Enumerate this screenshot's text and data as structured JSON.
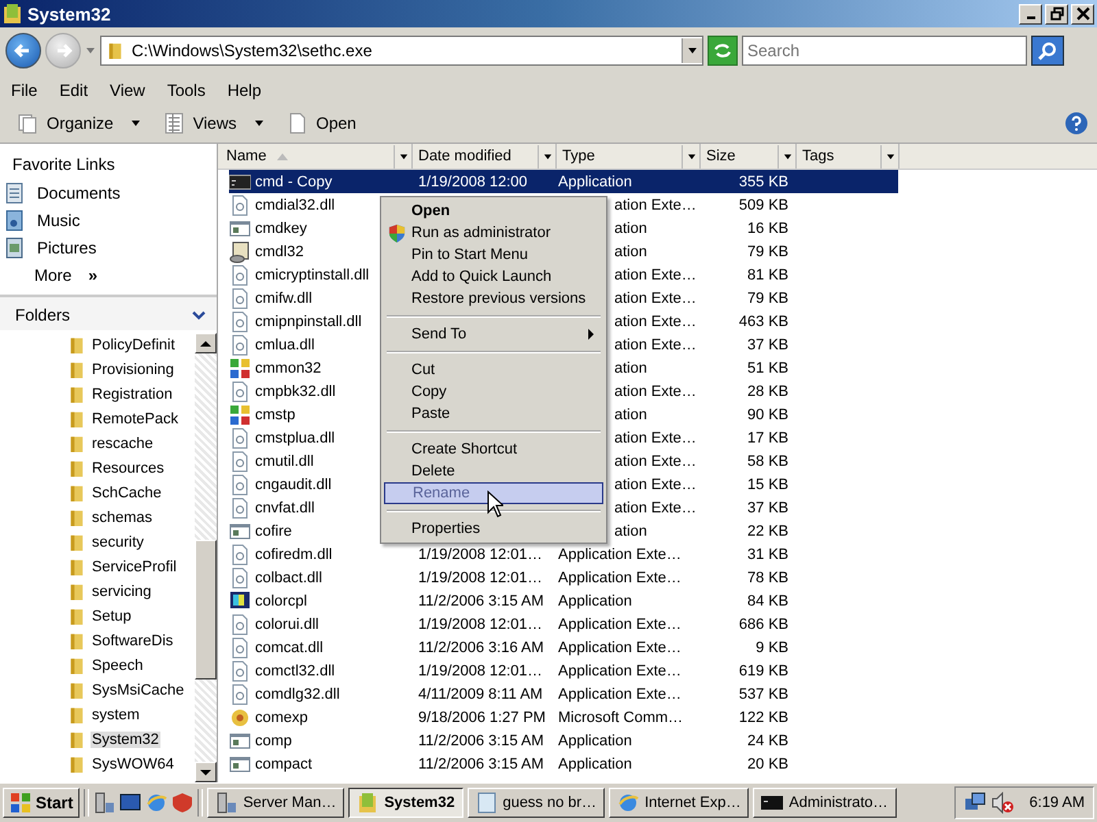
{
  "window": {
    "title": "System32"
  },
  "address": {
    "path": "C:\\Windows\\System32\\sethc.exe",
    "search_placeholder": "Search"
  },
  "menu_bar": [
    "File",
    "Edit",
    "View",
    "Tools",
    "Help"
  ],
  "toolbar": [
    {
      "label": "Organize",
      "kind": "organize",
      "dropdown": true
    },
    {
      "label": "Views",
      "kind": "views",
      "dropdown": true
    },
    {
      "label": "Open",
      "kind": "open",
      "dropdown": false
    }
  ],
  "favorites": {
    "title": "Favorite Links",
    "items": [
      {
        "label": "Documents",
        "kind": "documents"
      },
      {
        "label": "Music",
        "kind": "music"
      },
      {
        "label": "Pictures",
        "kind": "pictures"
      }
    ],
    "more": "More",
    "more_icon": "»"
  },
  "folders": {
    "title": "Folders",
    "items": [
      {
        "label": "PolicyDefinit",
        "selected": false
      },
      {
        "label": "Provisioning",
        "selected": false
      },
      {
        "label": "Registration",
        "selected": false
      },
      {
        "label": "RemotePack",
        "selected": false
      },
      {
        "label": "rescache",
        "selected": false
      },
      {
        "label": "Resources",
        "selected": false
      },
      {
        "label": "SchCache",
        "selected": false
      },
      {
        "label": "schemas",
        "selected": false
      },
      {
        "label": "security",
        "selected": false
      },
      {
        "label": "ServiceProfil",
        "selected": false
      },
      {
        "label": "servicing",
        "selected": false
      },
      {
        "label": "Setup",
        "selected": false
      },
      {
        "label": "SoftwareDis",
        "selected": false
      },
      {
        "label": "Speech",
        "selected": false
      },
      {
        "label": "SysMsiCache",
        "selected": false
      },
      {
        "label": "system",
        "selected": false
      },
      {
        "label": "System32",
        "selected": true
      },
      {
        "label": "SysWOW64",
        "selected": false
      }
    ]
  },
  "table": {
    "columns": [
      "Name",
      "Date modified",
      "Type",
      "Size",
      "Tags"
    ],
    "rows": [
      {
        "name": "cmd - Copy",
        "kind": "console",
        "date": "1/19/2008 12:00",
        "type": "Application",
        "size": "355 KB",
        "selected": true,
        "covered": false
      },
      {
        "name": "cmdial32.dll",
        "kind": "dll",
        "type": "ation Exte…",
        "size": "509 KB",
        "selected": false,
        "covered": true
      },
      {
        "name": "cmdkey",
        "kind": "app",
        "type": "ation",
        "size": "16 KB",
        "selected": false,
        "covered": true
      },
      {
        "name": "cmdl32",
        "kind": "tool",
        "type": "ation",
        "size": "79 KB",
        "selected": false,
        "covered": true
      },
      {
        "name": "cmicryptinstall.dll",
        "kind": "dll",
        "type": "ation Exte…",
        "size": "81 KB",
        "selected": false,
        "covered": true
      },
      {
        "name": "cmifw.dll",
        "kind": "dll",
        "type": "ation Exte…",
        "size": "79 KB",
        "selected": false,
        "covered": true
      },
      {
        "name": "cmipnpinstall.dll",
        "kind": "dll",
        "type": "ation Exte…",
        "size": "463 KB",
        "selected": false,
        "covered": true
      },
      {
        "name": "cmlua.dll",
        "kind": "dll",
        "type": "ation Exte…",
        "size": "37 KB",
        "selected": false,
        "covered": true
      },
      {
        "name": "cmmon32",
        "kind": "puzzle",
        "type": "ation",
        "size": "51 KB",
        "selected": false,
        "covered": true
      },
      {
        "name": "cmpbk32.dll",
        "kind": "dll",
        "type": "ation Exte…",
        "size": "28 KB",
        "selected": false,
        "covered": true
      },
      {
        "name": "cmstp",
        "kind": "puzzle",
        "type": "ation",
        "size": "90 KB",
        "selected": false,
        "covered": true
      },
      {
        "name": "cmstplua.dll",
        "kind": "dll",
        "type": "ation Exte…",
        "size": "17 KB",
        "selected": false,
        "covered": true
      },
      {
        "name": "cmutil.dll",
        "kind": "dll",
        "type": "ation Exte…",
        "size": "58 KB",
        "selected": false,
        "covered": true
      },
      {
        "name": "cngaudit.dll",
        "kind": "dll",
        "type": "ation Exte…",
        "size": "15 KB",
        "selected": false,
        "covered": true
      },
      {
        "name": "cnvfat.dll",
        "kind": "dll",
        "type": "ation Exte…",
        "size": "37 KB",
        "selected": false,
        "covered": true
      },
      {
        "name": "cofire",
        "kind": "app",
        "type": "ation",
        "size": "22 KB",
        "selected": false,
        "covered": true
      },
      {
        "name": "cofiredm.dll",
        "kind": "dll",
        "date": "1/19/2008 12:01…",
        "type": "Application Exte…",
        "size": "31 KB",
        "selected": false,
        "covered": false
      },
      {
        "name": "colbact.dll",
        "kind": "dll",
        "date": "1/19/2008 12:01…",
        "type": "Application Exte…",
        "size": "78 KB",
        "selected": false,
        "covered": false
      },
      {
        "name": "colorcpl",
        "kind": "monitor",
        "date": "11/2/2006 3:15 AM",
        "type": "Application",
        "size": "84 KB",
        "selected": false,
        "covered": false
      },
      {
        "name": "colorui.dll",
        "kind": "dll",
        "date": "1/19/2008 12:01…",
        "type": "Application Exte…",
        "size": "686 KB",
        "selected": false,
        "covered": false
      },
      {
        "name": "comcat.dll",
        "kind": "dll",
        "date": "11/2/2006 3:16 AM",
        "type": "Application Exte…",
        "size": "9 KB",
        "selected": false,
        "covered": false
      },
      {
        "name": "comctl32.dll",
        "kind": "dll",
        "date": "1/19/2008 12:01…",
        "type": "Application Exte…",
        "size": "619 KB",
        "selected": false,
        "covered": false
      },
      {
        "name": "comdlg32.dll",
        "kind": "dll",
        "date": "4/11/2009 8:11 AM",
        "type": "Application Exte…",
        "size": "537 KB",
        "selected": false,
        "covered": false
      },
      {
        "name": "comexp",
        "kind": "gear",
        "date": "9/18/2006 1:27 PM",
        "type": "Microsoft Comm…",
        "size": "122 KB",
        "selected": false,
        "covered": false
      },
      {
        "name": "comp",
        "kind": "app",
        "date": "11/2/2006 3:15 AM",
        "type": "Application",
        "size": "24 KB",
        "selected": false,
        "covered": false
      },
      {
        "name": "compact",
        "kind": "app",
        "date": "11/2/2006 3:15 AM",
        "type": "Application",
        "size": "20 KB",
        "selected": false,
        "covered": false
      }
    ]
  },
  "context_menu": [
    {
      "kind": "item",
      "label": "Open",
      "bold": true,
      "selected": false,
      "disabled": false
    },
    {
      "kind": "item",
      "label": "Run as administrator",
      "shield": true,
      "selected": false,
      "disabled": false
    },
    {
      "kind": "item",
      "label": "Pin to Start Menu",
      "selected": false,
      "disabled": false
    },
    {
      "kind": "item",
      "label": "Add to Quick Launch",
      "selected": false,
      "disabled": false
    },
    {
      "kind": "item",
      "label": "Restore previous versions",
      "selected": false,
      "disabled": false
    },
    {
      "kind": "separator"
    },
    {
      "kind": "item",
      "label": "Send To",
      "submenu": true,
      "selected": false,
      "disabled": false
    },
    {
      "kind": "separator"
    },
    {
      "kind": "item",
      "label": "Cut",
      "selected": false,
      "disabled": false
    },
    {
      "kind": "item",
      "label": "Copy",
      "selected": false,
      "disabled": false
    },
    {
      "kind": "item",
      "label": "Paste",
      "selected": false,
      "disabled": false
    },
    {
      "kind": "separator"
    },
    {
      "kind": "item",
      "label": "Create Shortcut",
      "selected": false,
      "disabled": false
    },
    {
      "kind": "item",
      "label": "Delete",
      "selected": false,
      "disabled": false
    },
    {
      "kind": "item",
      "label": "Rename",
      "selected": true,
      "disabled": true
    },
    {
      "kind": "separator"
    },
    {
      "kind": "item",
      "label": "Properties",
      "selected": false,
      "disabled": false
    }
  ],
  "taskbar": {
    "start": "Start",
    "tasks": [
      {
        "label": "Server Man…",
        "kind": "server",
        "selected": false
      },
      {
        "label": "System32",
        "kind": "folder",
        "selected": true
      },
      {
        "label": "guess no br…",
        "kind": "notepad",
        "selected": false
      },
      {
        "label": "Internet Exp…",
        "kind": "browser",
        "selected": false
      },
      {
        "label": "Administrato…",
        "kind": "console",
        "selected": false
      }
    ],
    "clock": "6:19 AM"
  }
}
